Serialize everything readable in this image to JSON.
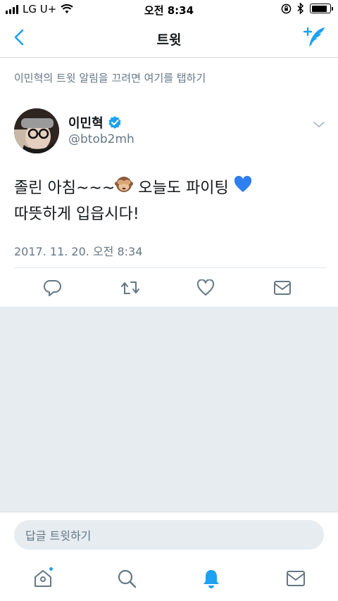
{
  "status_bar": {
    "carrier": "LG U+",
    "time": "오전 8:34",
    "battery_level": 0.85
  },
  "nav": {
    "title": "트윗",
    "back_icon": "chevron-left-icon",
    "compose_icon": "compose-tweet-icon"
  },
  "notification_hint": "이민혁의 트윗 알림을 끄려면 여기를 탭하기",
  "tweet": {
    "user_name": "이민혁",
    "verified": true,
    "handle": "@btob2mh",
    "text_line1_a": "졸린 아침~~~",
    "text_line1_emoji1": "🙈",
    "text_line1_b": " 오늘도 파이팅 ",
    "text_line1_emoji2": "💙",
    "text_line2": "따뜻하게 입읍시다!",
    "timestamp": "2017. 11. 20. 오전 8:34"
  },
  "actions": [
    "reply-icon",
    "retweet-icon",
    "like-icon",
    "direct-message-icon"
  ],
  "reply_bar": {
    "placeholder": "답글 트윗하기"
  },
  "tab_bar": {
    "items": [
      "home-icon",
      "search-icon",
      "notifications-icon",
      "messages-icon"
    ],
    "active": "notifications-icon"
  },
  "colors": {
    "accent": "#1da1f2",
    "text": "#14171a",
    "secondary": "#657786",
    "background_gray": "#e6ecf0"
  }
}
